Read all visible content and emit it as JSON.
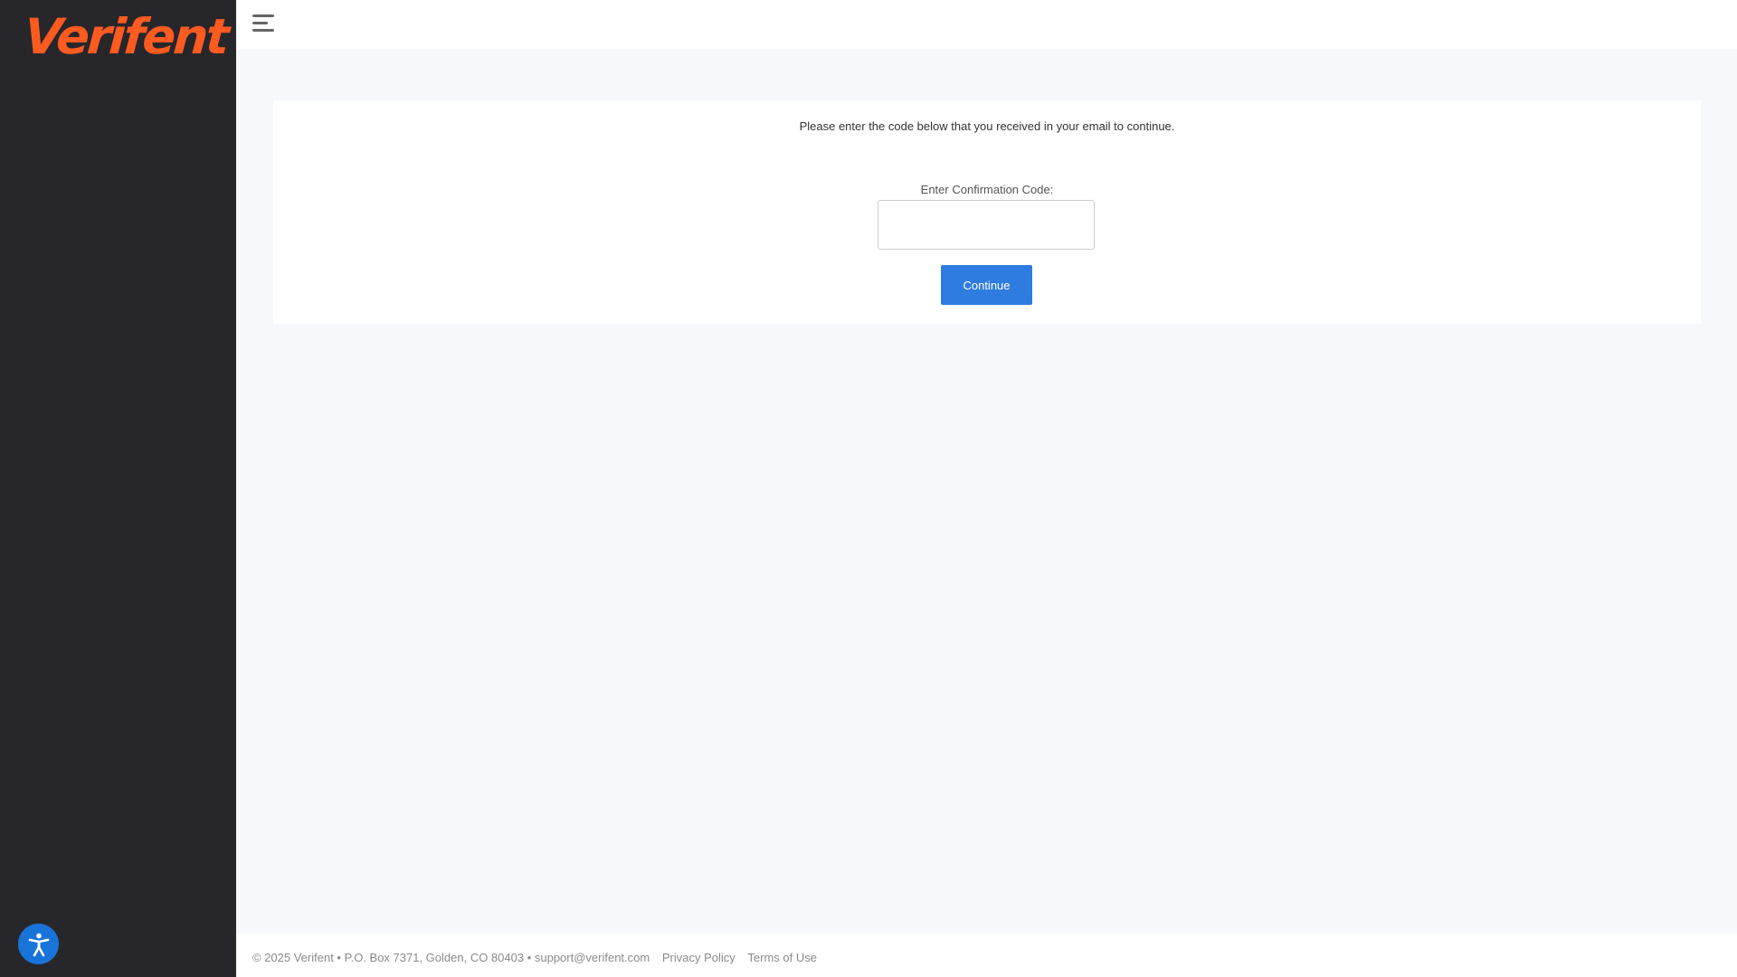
{
  "sidebar": {
    "logo_text": "Verifent",
    "logo_color": "#ff5a1f",
    "accessibility_icon": "accessibility-person-icon"
  },
  "header": {
    "menu_icon": "hamburger-menu-icon"
  },
  "main": {
    "instructions": "Please enter the code below that you received in your email to continue.",
    "code_label": "Enter Confirmation Code:",
    "code_value": "",
    "code_placeholder": "",
    "continue_label": "Continue",
    "button_color": "#2f7ce0"
  },
  "footer": {
    "company_info": "© 2025 Verifent • P.O. Box 7371, Golden, CO 80403 • support@verifent.com",
    "privacy_label": "Privacy Policy",
    "terms_label": "Terms of Use"
  }
}
